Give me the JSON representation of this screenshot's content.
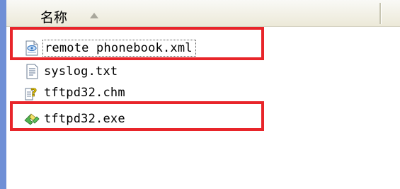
{
  "header": {
    "name_column": "名称"
  },
  "files": [
    {
      "name": "remote phonebook.xml",
      "icon": "xml-file-icon"
    },
    {
      "name": "syslog.txt",
      "icon": "text-file-icon"
    },
    {
      "name": "tftpd32.chm",
      "icon": "help-file-icon"
    },
    {
      "name": "tftpd32.exe",
      "icon": "exe-file-icon"
    }
  ],
  "colors": {
    "highlight": "#e8252a",
    "left_strip": "#6f8fd6",
    "header_bg": "#ece9d8"
  }
}
